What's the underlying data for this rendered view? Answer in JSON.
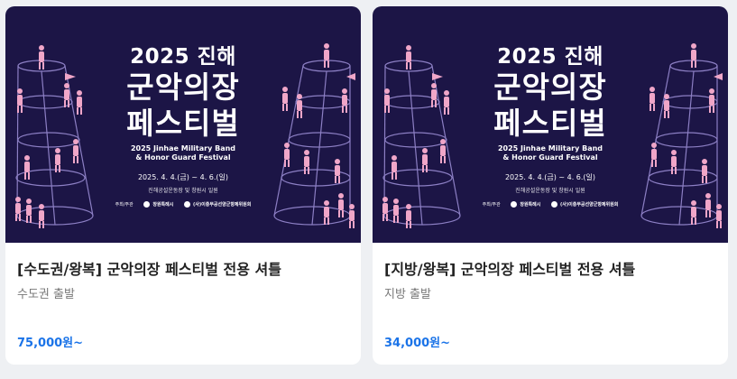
{
  "products": [
    {
      "poster": {
        "year_title": "2025 진해",
        "title_line1": "군악의장",
        "title_line2": "페스티벌",
        "en_line1": "2025 Jinhae Military Band",
        "en_line2": "& Honor Guard Festival",
        "dates": "2025. 4. 4.(금) ~ 4. 6.(일)",
        "venue": "진해공설운동장 및 창원시 일원",
        "sponsor1": "주최/주관",
        "sponsor2": "창원특례시",
        "sponsor3": "(사)이충무공선양군항제위원회"
      },
      "title": "[수도권/왕복] 군악의장 페스티벌 전용 셔틀",
      "subtitle": "수도권 출발",
      "price": "75,000원~"
    },
    {
      "poster": {
        "year_title": "2025 진해",
        "title_line1": "군악의장",
        "title_line2": "페스티벌",
        "en_line1": "2025 Jinhae Military Band",
        "en_line2": "& Honor Guard Festival",
        "dates": "2025. 4. 4.(금) ~ 4. 6.(일)",
        "venue": "진해공설운동장 및 창원시 일원",
        "sponsor1": "주최/주관",
        "sponsor2": "창원특례시",
        "sponsor3": "(사)이충무공선양군항제위원회"
      },
      "title": "[지방/왕복] 군악의장 페스티벌 전용 셔틀",
      "subtitle": "지방 출발",
      "price": "34,000원~"
    }
  ],
  "colors": {
    "poster_bg": "#1c1546",
    "figure_pink": "#f0a6c8",
    "line_lavender": "#8c7fc4",
    "price_blue": "#1a73e8"
  }
}
